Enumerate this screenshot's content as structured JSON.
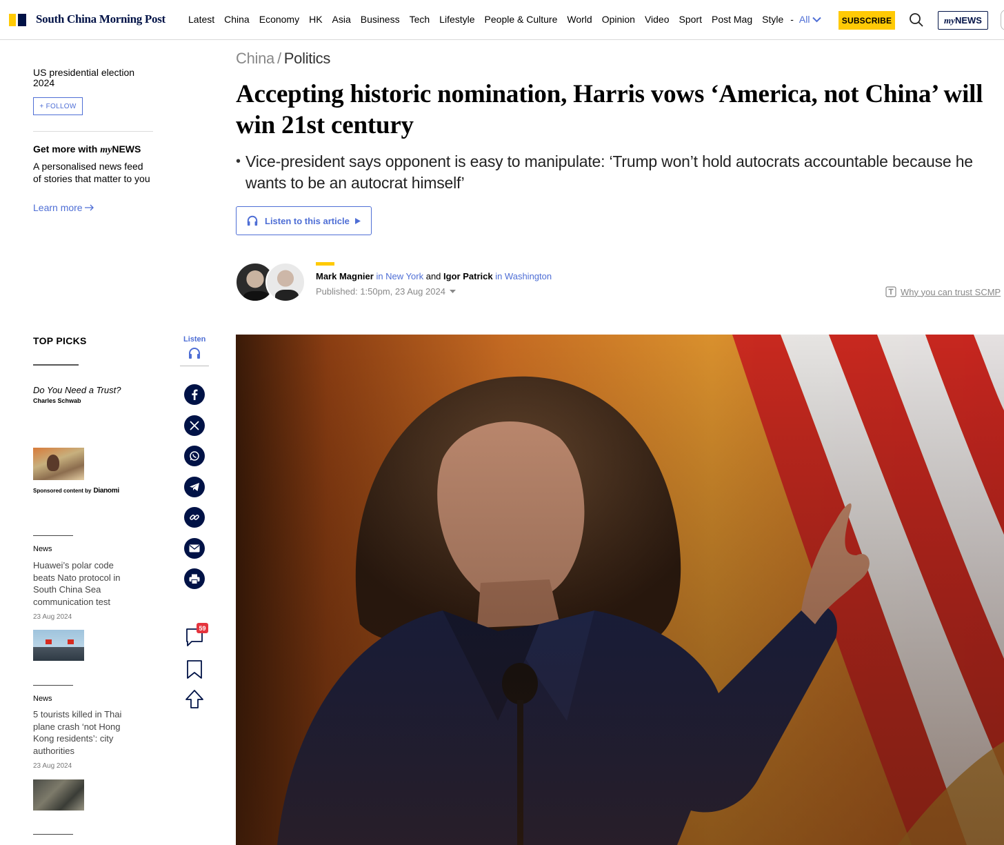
{
  "site": {
    "logo_text": "South China Morning Post"
  },
  "nav": {
    "items": [
      "Latest",
      "China",
      "Economy",
      "HK",
      "Asia",
      "Business",
      "Tech",
      "Lifestyle",
      "People & Culture",
      "World",
      "Opinion",
      "Video",
      "Sport",
      "Post Mag",
      "Style"
    ],
    "separator": "-",
    "all_label": "All",
    "subscribe_label": "SUBSCRIBE",
    "mynews_my": "my",
    "mynews_news": "NEWS"
  },
  "sidebar": {
    "topic_title": "US presidential election 2024",
    "follow_label": "+ FOLLOW",
    "mynews": {
      "title_prefix": "Get more with ",
      "brand_my": "my",
      "brand_news": "NEWS",
      "description": "A personalised news feed of stories that matter to you",
      "learn_more": "Learn more"
    },
    "top_picks_label": "TOP PICKS",
    "promo": {
      "title": "Do You Need a Trust?",
      "sponsor": "Charles Schwab",
      "sponsored_text": "Sponsored content by",
      "sponsored_brand": "Dianomi"
    },
    "news": [
      {
        "category": "News",
        "headline": "Huawei’s polar code beats Nato protocol in South China Sea communication test",
        "date": "23 Aug 2024"
      },
      {
        "category": "News",
        "headline": "5 tourists killed in Thai plane crash ‘not Hong Kong residents’: city authorities",
        "date": "23 Aug 2024"
      }
    ]
  },
  "share_rail": {
    "listen_label": "Listen",
    "comment_count": "59",
    "buttons": [
      "facebook-icon",
      "x-icon",
      "whatsapp-icon",
      "telegram-icon",
      "link-icon",
      "email-icon",
      "print-icon"
    ]
  },
  "article": {
    "breadcrumb": {
      "section": "China",
      "separator": "/",
      "subsection": "Politics"
    },
    "headline": "Accepting historic nomination, Harris vows ‘America, not China’ will win 21st century",
    "summary_bullet": "•",
    "summary": "Vice-president says opponent is easy to manipulate: ‘Trump won’t hold autocrats accountable because he wants to be an autocrat himself’",
    "listen_label": "Listen to this article",
    "authors": [
      {
        "name": "Mark Magnier",
        "location": "in New York"
      },
      {
        "name": "Igor Patrick",
        "location": "in Washington"
      }
    ],
    "author_joiner": "and",
    "published": "Published: 1:50pm, 23 Aug 2024",
    "trust_link": "Why you can trust SCMP"
  },
  "colors": {
    "brand_navy": "#001246",
    "brand_yellow": "#ffca05",
    "link_blue": "#4e6ed5",
    "badge_red": "#e5343d"
  }
}
